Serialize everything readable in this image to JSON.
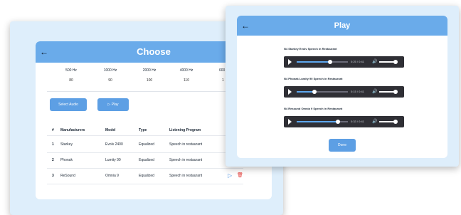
{
  "choose": {
    "title": "Choose",
    "back_icon": "←",
    "frequencies": [
      {
        "label": "500 Hz",
        "value": "80"
      },
      {
        "label": "1000 Hz",
        "value": "90"
      },
      {
        "label": "2000 Hz",
        "value": "100"
      },
      {
        "label": "4000 Hz",
        "value": "110"
      },
      {
        "label": "600",
        "value": "1"
      }
    ],
    "select_audio_label": "Select Audio",
    "play_label": "▷ Play",
    "table": {
      "headers": [
        "#",
        "Manufacturers",
        "Model",
        "Type",
        "Listening Program"
      ],
      "rows": [
        {
          "num": "1",
          "manufacturer": "Starkey",
          "model": "Evolv 2400",
          "type": "Equalized",
          "program": "Speech in restaurant"
        },
        {
          "num": "2",
          "manufacturer": "Phonak",
          "model": "Lumity 90",
          "type": "Equalized",
          "program": "Speech in restaurant"
        },
        {
          "num": "3",
          "manufacturer": "ReSound",
          "model": "Omnia 9",
          "type": "Equalized",
          "program": "Speech in restaurant"
        }
      ],
      "row_actions": {
        "play_icon": "▷",
        "delete_icon": "🗑"
      }
    }
  },
  "play": {
    "title": "Play",
    "back_icon": "←",
    "tracks": [
      {
        "title": "N4 Starkey Evolv Speech in Restaurant",
        "time": "0:25 / 0:41",
        "progress": 0.65
      },
      {
        "title": "N4 Phonak Lumity 90 Speech in Restaurant",
        "time": "0:15 / 0:41",
        "progress": 0.35
      },
      {
        "title": "N4 Resound Omnia 9 Speech in Restaurant",
        "time": "0:33 / 0:41",
        "progress": 0.8
      }
    ],
    "volume_icon": "🔊",
    "done_label": "Done"
  },
  "colors": {
    "header": "#6aabea",
    "button": "#5d9fe4",
    "window_bg": "#deeefb",
    "player_bg": "#2f2f35"
  }
}
